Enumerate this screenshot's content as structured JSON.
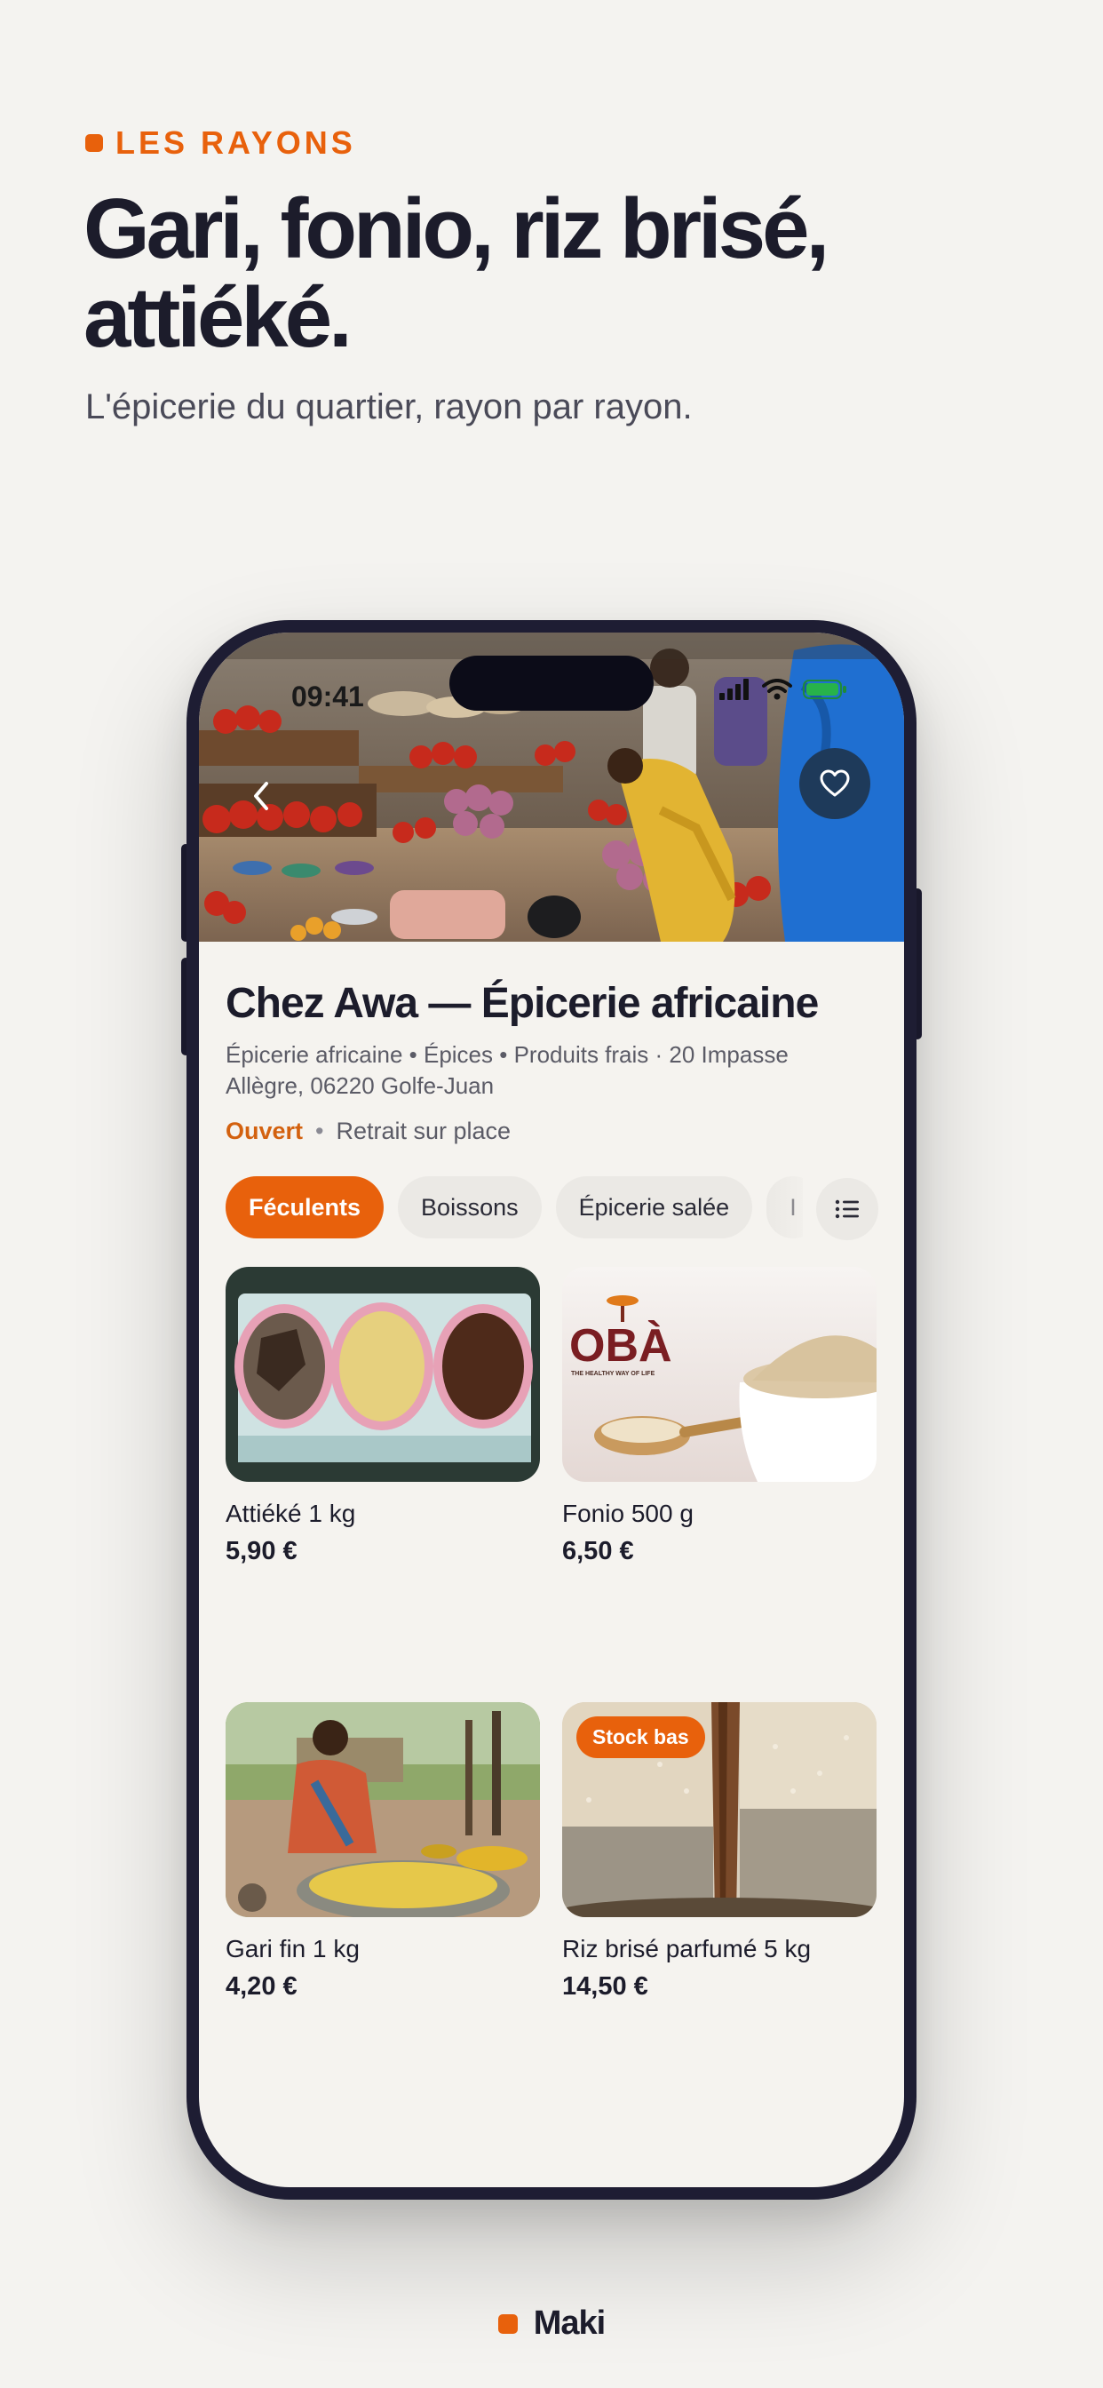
{
  "marketing": {
    "eyebrow": "LES RAYONS",
    "headline": "Gari, fonio, riz brisé, attiéké.",
    "subheadline": "L'épicerie du quartier, rayon par rayon."
  },
  "status_bar": {
    "time": "09:41"
  },
  "store": {
    "name": "Chez Awa — Épicerie africaine",
    "meta": "Épicerie africaine • Épices • Produits frais · 20 Impasse Allègre, 06220 Golfe-Juan",
    "status": "Ouvert",
    "separator": "•",
    "pickup": "Retrait sur place"
  },
  "categories": [
    {
      "label": "Féculents",
      "active": true
    },
    {
      "label": "Boissons",
      "active": false
    },
    {
      "label": "Épicerie salée",
      "active": false
    },
    {
      "label": "I",
      "active": false
    }
  ],
  "products": [
    {
      "name": "Attiéké 1 kg",
      "price": "5,90 €"
    },
    {
      "name": "Fonio 500 g",
      "price": "6,50 €",
      "brand_logo": "OBÀ",
      "brand_tagline": "THE HEALTHY WAY OF LIFE"
    },
    {
      "name": "Gari fin 1 kg",
      "price": "4,20 €"
    },
    {
      "name": "Riz brisé parfumé 5 kg",
      "price": "14,50 €",
      "badge": "Stock bas"
    }
  ],
  "icons": {
    "back": "chevron-left-icon",
    "favorite": "heart-icon",
    "list": "list-icon"
  },
  "colors": {
    "accent": "#e8610c",
    "ink": "#1c1c2b",
    "background": "#f4f3f0",
    "phone_frame": "#1e1d33"
  },
  "footer": {
    "brand": "Maki"
  }
}
